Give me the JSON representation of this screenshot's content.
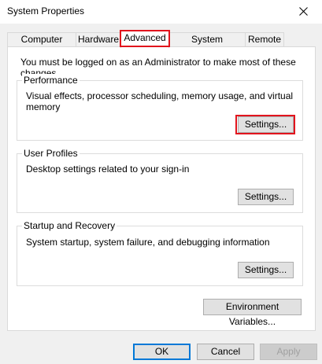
{
  "window": {
    "title": "System Properties"
  },
  "tabs": [
    {
      "label": "Computer Name"
    },
    {
      "label": "Hardware"
    },
    {
      "label": "Advanced"
    },
    {
      "label": "System Protection"
    },
    {
      "label": "Remote"
    }
  ],
  "active_tab": "Advanced",
  "highlight_color": "#e2141d",
  "content": {
    "admin_note": "You must be logged on as an Administrator to make most of these changes.",
    "performance": {
      "title": "Performance",
      "description": "Visual effects, processor scheduling, memory usage, and virtual memory",
      "button": "Settings..."
    },
    "user_profiles": {
      "title": "User Profiles",
      "description": "Desktop settings related to your sign-in",
      "button": "Settings..."
    },
    "startup_recovery": {
      "title": "Startup and Recovery",
      "description": "System startup, system failure, and debugging information",
      "button": "Settings..."
    },
    "env_button": "Environment Variables..."
  },
  "footer": {
    "ok": "OK",
    "cancel": "Cancel",
    "apply": "Apply"
  },
  "icons": {
    "close": "close-icon"
  }
}
